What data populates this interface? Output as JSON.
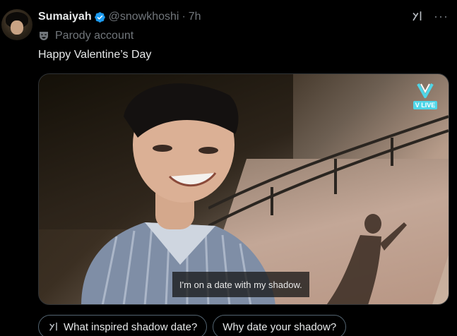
{
  "author": {
    "name": "Sumaiyah",
    "handle": "@snowkhoshi",
    "time": "7h",
    "dot": "·",
    "parody_label": "Parody account"
  },
  "tweet": {
    "text": "Happy Valentine’s Day"
  },
  "media": {
    "subtitle": "I'm on a date with my shadow.",
    "watermark": "V LIVE"
  },
  "actions": {
    "more": "···"
  },
  "suggestions": [
    {
      "label": "What inspired shadow date?"
    },
    {
      "label": "Why date your shadow?"
    }
  ],
  "colors": {
    "background": "#000000",
    "primary_text": "#e7e9ea",
    "secondary_text": "#71767b",
    "verified": "#1d9bf0",
    "chip_border": "#536471"
  },
  "icons": {
    "verified": "verified-badge-icon",
    "parody": "parody-mask-icon",
    "grok": "grok-icon",
    "more": "more-dots-icon"
  }
}
